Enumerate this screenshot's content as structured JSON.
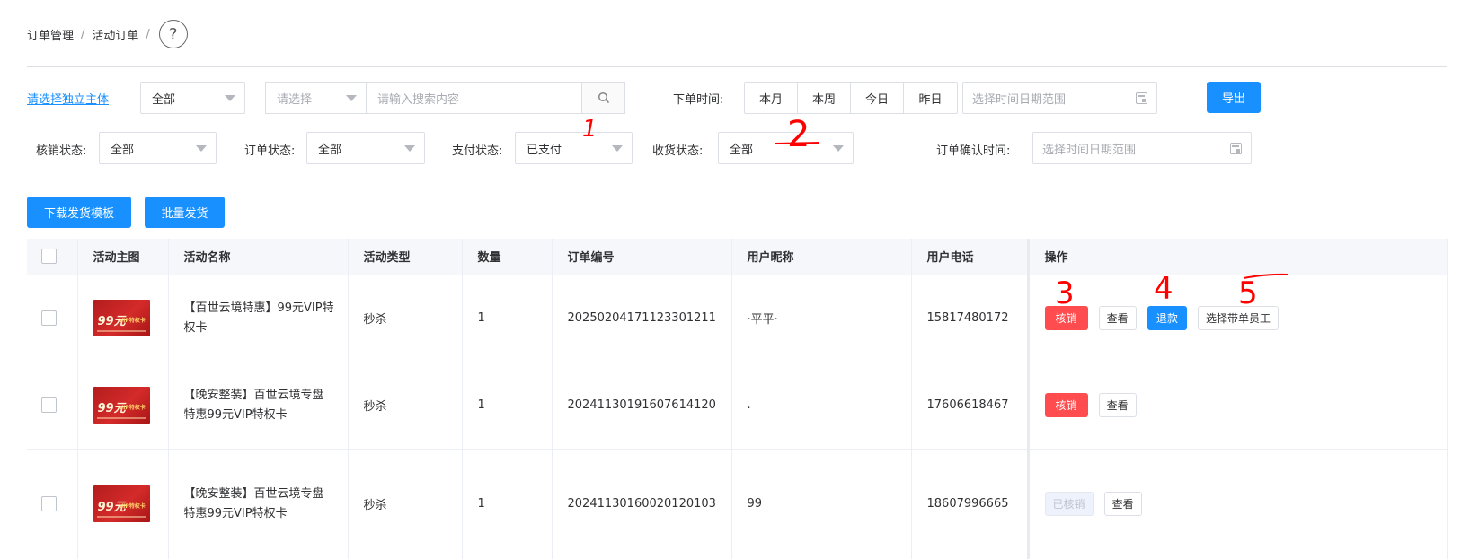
{
  "breadcrumb": {
    "items": [
      "订单管理",
      "活动订单"
    ],
    "sep": "/",
    "help": "?"
  },
  "filters": {
    "entity_link": "请选择独立主体",
    "scope_select": "全部",
    "search_field_placeholder": "请选择",
    "search_input_placeholder": "请输入搜索内容",
    "order_time_label": "下单时间:",
    "time_buttons": [
      "本月",
      "本周",
      "今日",
      "昨日"
    ],
    "date_range_placeholder": "选择时间日期范围",
    "export_label": "导出",
    "verify_status_label": "核销状态:",
    "verify_status_value": "全部",
    "order_status_label": "订单状态:",
    "order_status_value": "全部",
    "pay_status_label": "支付状态:",
    "pay_status_value": "已支付",
    "receive_status_label": "收货状态:",
    "receive_status_value": "全部",
    "confirm_time_label": "订单确认时间:",
    "confirm_date_placeholder": "选择时间日期范围"
  },
  "actions": {
    "download_template": "下载发货模板",
    "batch_ship": "批量发货"
  },
  "table": {
    "headers": [
      "活动主图",
      "活动名称",
      "活动类型",
      "数量",
      "订单编号",
      "用户昵称",
      "用户电话",
      "操作"
    ],
    "thumb_text": {
      "big": "99元",
      "vip": "VIP特权卡"
    },
    "rows": [
      {
        "name": "【百世云境特惠】99元VIP特权卡",
        "type": "秒杀",
        "qty": "1",
        "order_no": "20250204171123301211",
        "nickname": "·平平·",
        "phone": "15817480172",
        "ops": {
          "verify": "核销",
          "view": "查看",
          "refund": "退款",
          "assign": "选择带单员工"
        }
      },
      {
        "name": "【晚安整装】百世云境专盘特惠99元VIP特权卡",
        "type": "秒杀",
        "qty": "1",
        "order_no": "20241130191607614120",
        "nickname": ".",
        "phone": "17606618467",
        "ops": {
          "verify": "核销",
          "view": "查看"
        }
      },
      {
        "name": "【晚安整装】百世云境专盘特惠99元VIP特权卡",
        "type": "秒杀",
        "qty": "1",
        "order_no": "20241130160020120103",
        "nickname": "99",
        "phone": "18607996665",
        "ops": {
          "verified": "已核销",
          "view": "查看"
        }
      }
    ]
  },
  "annotations": [
    "1",
    "2",
    "3",
    "4",
    "5"
  ],
  "colors": {
    "primary": "#1890ff",
    "danger": "#ff4d4f",
    "annotation": "#ff0000"
  }
}
